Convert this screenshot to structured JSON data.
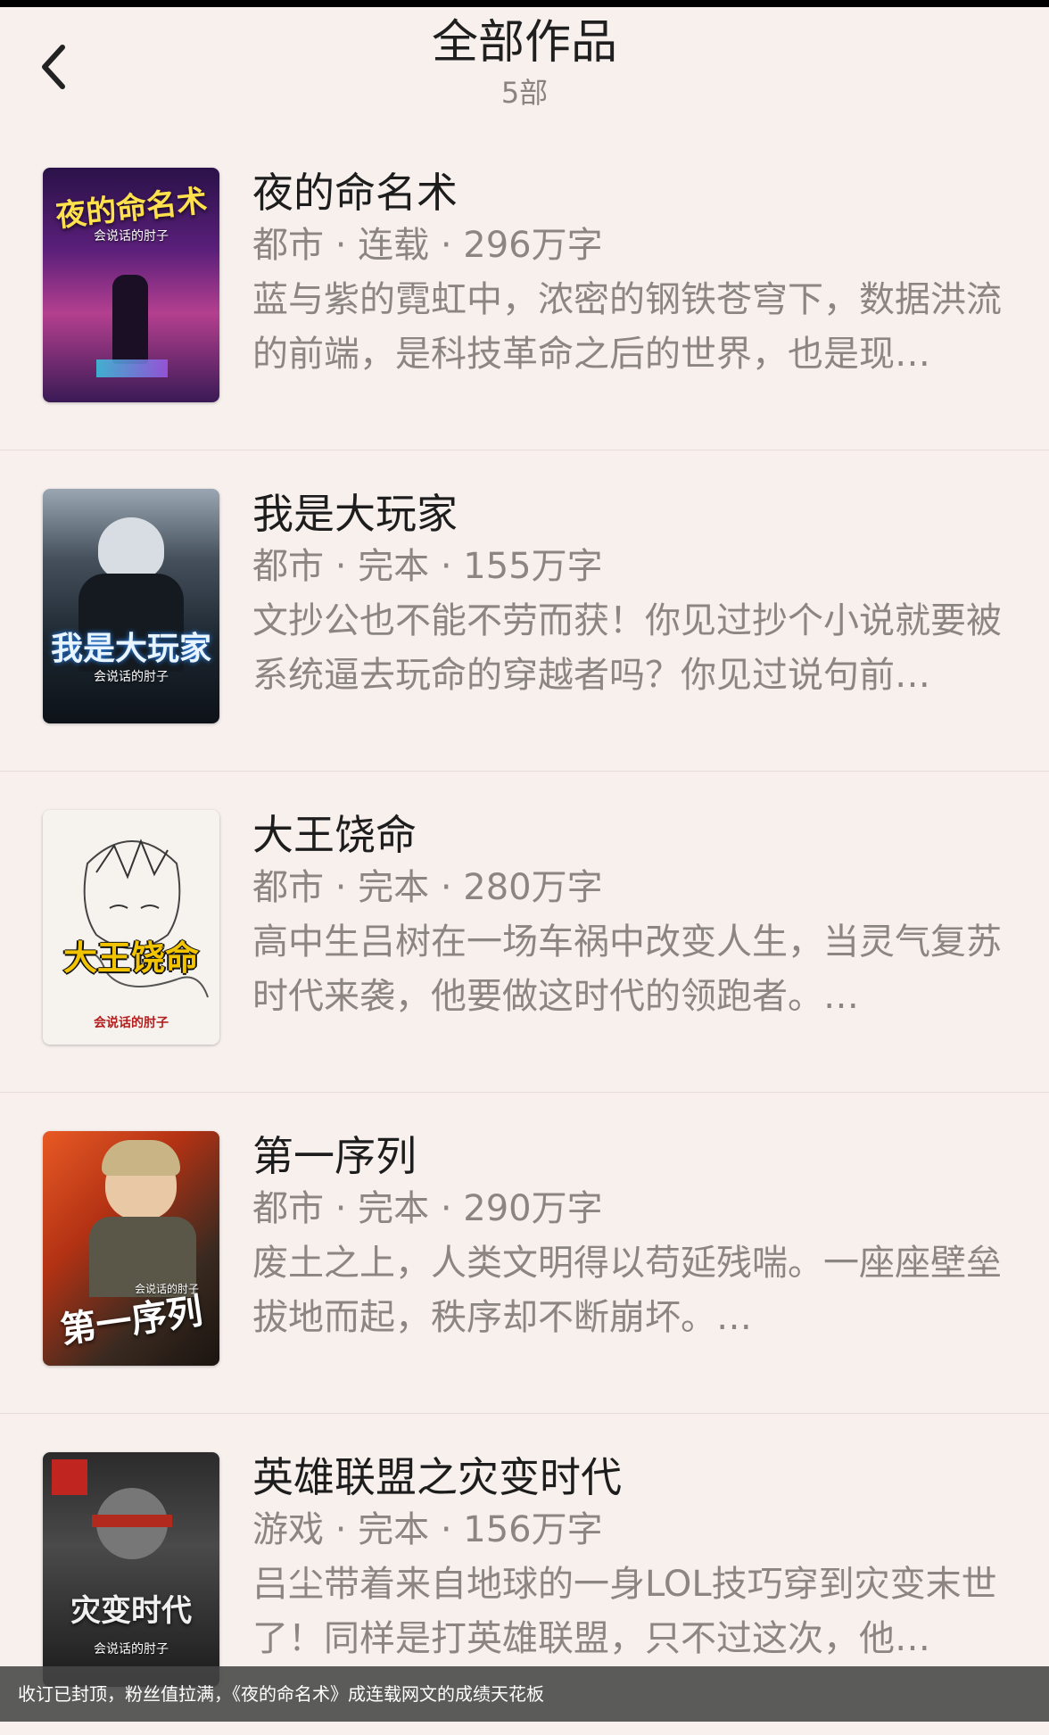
{
  "header": {
    "title": "全部作品",
    "count": "5部"
  },
  "books": [
    {
      "title": "夜的命名术",
      "meta": "都市 · 连载 · 296万字",
      "desc": "蓝与紫的霓虹中，浓密的钢铁苍穹下，数据洪流的前端，是科技革命之后的世界，也是现…",
      "cover": {
        "title": "夜的命名术",
        "author": "会说话的肘子"
      }
    },
    {
      "title": "我是大玩家",
      "meta": "都市 · 完本 · 155万字",
      "desc": "文抄公也不能不劳而获！你见过抄个小说就要被系统逼去玩命的穿越者吗？你见过说句前…",
      "cover": {
        "title": "我是大玩家",
        "author": "会说话的肘子"
      }
    },
    {
      "title": "大王饶命",
      "meta": "都市 · 完本 · 280万字",
      "desc": "高中生吕树在一场车祸中改变人生，当灵气复苏时代来袭，他要做这时代的领跑者。…",
      "cover": {
        "title": "大王饶命",
        "author": "会说话的肘子"
      }
    },
    {
      "title": "第一序列",
      "meta": "都市 · 完本 · 290万字",
      "desc": "废土之上，人类文明得以苟延残喘。一座座壁垒拔地而起，秩序却不断崩坏。…",
      "cover": {
        "title": "第一序列",
        "author": "会说话的肘子"
      }
    },
    {
      "title": "英雄联盟之灾变时代",
      "meta": "游戏 · 完本 · 156万字",
      "desc": "吕尘带着来自地球的一身LOL技巧穿到灾变末世了！同样是打英雄联盟，只不过这次，他…",
      "cover": {
        "title": "灾变时代",
        "author": "会说话的肘子"
      }
    }
  ],
  "caption": "收订已封顶，粉丝值拉满，《夜的命名术》成连载网文的成绩天花板",
  "icons": {
    "back": "chevron-left-icon"
  }
}
